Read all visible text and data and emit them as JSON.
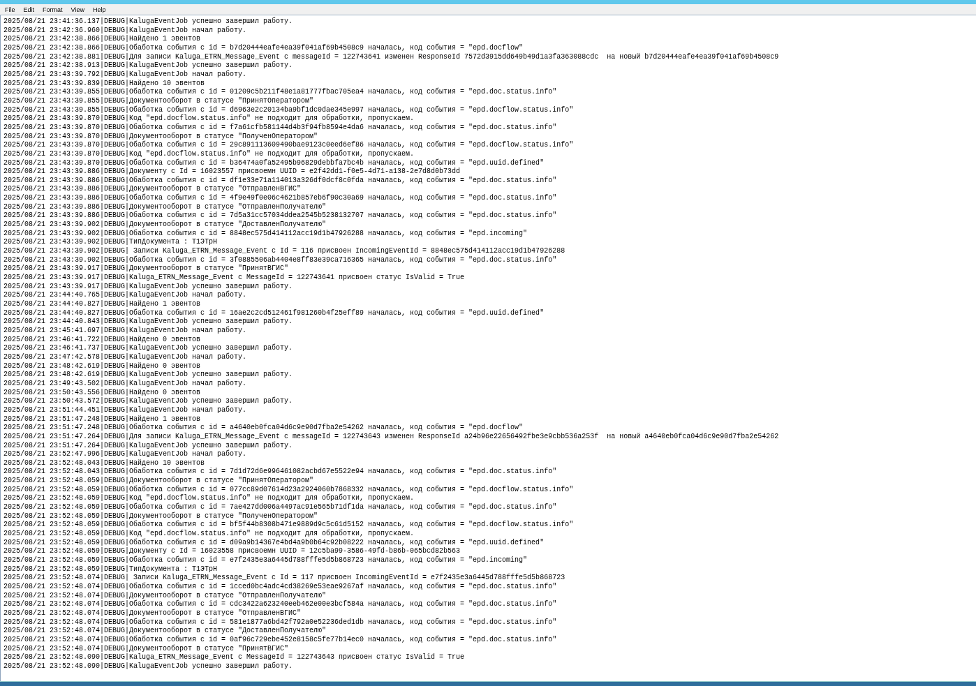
{
  "menu": [
    {
      "label": "File"
    },
    {
      "label": "Edit"
    },
    {
      "label": "Format"
    },
    {
      "label": "View"
    },
    {
      "label": "Help"
    }
  ],
  "lines": [
    "2025/08/21 23:41:36.137|DEBUG|KalugaEventJob успешно завершил работу.",
    "2025/08/21 23:42:36.960|DEBUG|KalugaEventJob начал работу.",
    "2025/08/21 23:42:38.866|DEBUG|Найдено 1 эвентов",
    "2025/08/21 23:42:38.866|DEBUG|Обаботка события с id = b7d20444eafe4ea39f041af69b4508c9 началась, код события = \"epd.docflow\"",
    "2025/08/21 23:42:38.881|DEBUG|Для записи Kaluga_ETRN_Message_Event с messageId = 122743641 изменен ResponseId 7572d3915dd649b49d1a3fa363088cdc  на новый b7d20444eafe4ea39f041af69b4508c9",
    "2025/08/21 23:42:38.913|DEBUG|KalugaEventJob успешно завершил работу.",
    "2025/08/21 23:43:39.792|DEBUG|KalugaEventJob начал работу.",
    "2025/08/21 23:43:39.839|DEBUG|Найдено 10 эвентов",
    "2025/08/21 23:43:39.855|DEBUG|Обаботка события с id = 01209c5b211f48e1a81777fbac705ea4 началась, код события = \"epd.doc.status.info\"",
    "2025/08/21 23:43:39.855|DEBUG|Документооборот в статусе \"ПринятОператором\"",
    "2025/08/21 23:43:39.855|DEBUG|Обаботка события с id = d6963e2c20134ba9bf1dc0dae345e997 началась, код события = \"epd.docflow.status.info\"",
    "2025/08/21 23:43:39.870|DEBUG|Код \"epd.docflow.status.info\" не подходит для обработки, пропускаем.",
    "2025/08/21 23:43:39.870|DEBUG|Обаботка события с id = f7a61cfb581144d4b3f94fb8594e4da6 началась, код события = \"epd.doc.status.info\"",
    "2025/08/21 23:43:39.870|DEBUG|Документооборот в статусе \"ПолученОператором\"",
    "2025/08/21 23:43:39.870|DEBUG|Обаботка события с id = 29c891113609490bae9123c0eed6ef86 началась, код события = \"epd.docflow.status.info\"",
    "2025/08/21 23:43:39.870|DEBUG|Код \"epd.docflow.status.info\" не подходит для обработки, пропускаем.",
    "2025/08/21 23:43:39.870|DEBUG|Обаботка события с id = b36474a0fa52495b96829debbfa7bc4b началась, код события = \"epd.uuid.defined\"",
    "2025/08/21 23:43:39.886|DEBUG|Документу с Id = 16023557 присвоемн UUID = e2f42dd1-f0e5-4d71-a138-2e7d8d0b73dd",
    "2025/08/21 23:43:39.886|DEBUG|Обаботка события с id = df1e33e71a114013a326df0dcf8c0fda началась, код события = \"epd.doc.status.info\"",
    "2025/08/21 23:43:39.886|DEBUG|Документооборот в статусе \"ОтправленВГИС\"",
    "2025/08/21 23:43:39.886|DEBUG|Обаботка события с id = 4f9e49f0e06c4621b857eb6f90c30a69 началась, код события = \"epd.doc.status.info\"",
    "2025/08/21 23:43:39.886|DEBUG|Документооборот в статусе \"ОтправленПолучателю\"",
    "2025/08/21 23:43:39.886|DEBUG|Обаботка события с id = 7d5a31cc57034ddea2545b5238132707 началась, код события = \"epd.doc.status.info\"",
    "2025/08/21 23:43:39.902|DEBUG|Документооборот в статусе \"ДоставленПолучателю\"",
    "2025/08/21 23:43:39.902|DEBUG|Обаботка события с id = 8848ec575d414112acc19d1b47926288 началась, код события = \"epd.incoming\"",
    "2025/08/21 23:43:39.902|DEBUG|ТипДокумента : Т1ЭТрН",
    "2025/08/21 23:43:39.902|DEBUG| Записи Kaluga_ETRN_Message_Event с Id = 116 присвоен IncomingEventId = 8848ec575d414112acc19d1b47926288",
    "2025/08/21 23:43:39.902|DEBUG|Обаботка события с id = 3f0885506ab4404e8ff83e39ca716365 началась, код события = \"epd.doc.status.info\"",
    "2025/08/21 23:43:39.917|DEBUG|Документооборот в статусе \"ПринятВГИС\"",
    "2025/08/21 23:43:39.917|DEBUG|Kaluga_ETRN_Message_Event с MessageId = 122743641 присвоен статус IsValid = True",
    "2025/08/21 23:43:39.917|DEBUG|KalugaEventJob успешно завершил работу.",
    "2025/08/21 23:44:40.765|DEBUG|KalugaEventJob начал работу.",
    "2025/08/21 23:44:40.827|DEBUG|Найдено 1 эвентов",
    "2025/08/21 23:44:40.827|DEBUG|Обаботка события с id = 16ae2c2cd512461f981260b4f25eff89 началась, код события = \"epd.uuid.defined\"",
    "2025/08/21 23:44:40.843|DEBUG|KalugaEventJob успешно завершил работу.",
    "2025/08/21 23:45:41.697|DEBUG|KalugaEventJob начал работу.",
    "2025/08/21 23:46:41.722|DEBUG|Найдено 0 эвентов",
    "2025/08/21 23:46:41.737|DEBUG|KalugaEventJob успешно завершил работу.",
    "2025/08/21 23:47:42.578|DEBUG|KalugaEventJob начал работу.",
    "2025/08/21 23:48:42.619|DEBUG|Найдено 0 эвентов",
    "2025/08/21 23:48:42.619|DEBUG|KalugaEventJob успешно завершил работу.",
    "2025/08/21 23:49:43.502|DEBUG|KalugaEventJob начал работу.",
    "2025/08/21 23:50:43.556|DEBUG|Найдено 0 эвентов",
    "2025/08/21 23:50:43.572|DEBUG|KalugaEventJob успешно завершил работу.",
    "2025/08/21 23:51:44.451|DEBUG|KalugaEventJob начал работу.",
    "2025/08/21 23:51:47.248|DEBUG|Найдено 1 эвентов",
    "2025/08/21 23:51:47.248|DEBUG|Обаботка события с id = a4640eb0fca04d6c9e90d7fba2e54262 началась, код события = \"epd.docflow\"",
    "2025/08/21 23:51:47.264|DEBUG|Для записи Kaluga_ETRN_Message_Event с messageId = 122743643 изменен ResponseId a24b96e22656492fbe3e9cbb536a253f  на новый a4640eb0fca04d6c9e90d7fba2e54262",
    "2025/08/21 23:51:47.264|DEBUG|KalugaEventJob успешно завершил работу.",
    "2025/08/21 23:52:47.996|DEBUG|KalugaEventJob начал работу.",
    "2025/08/21 23:52:48.043|DEBUG|Найдено 10 эвентов",
    "2025/08/21 23:52:48.043|DEBUG|Обаботка события с id = 7d1d72d6e996461082acbd67e5522e94 началась, код события = \"epd.doc.status.info\"",
    "2025/08/21 23:52:48.059|DEBUG|Документооборот в статусе \"ПринятОператором\"",
    "2025/08/21 23:52:48.059|DEBUG|Обаботка события с id = 077cc89d07614d23a2924060b7868332 началась, код события = \"epd.docflow.status.info\"",
    "2025/08/21 23:52:48.059|DEBUG|Код \"epd.docflow.status.info\" не подходит для обработки, пропускаем.",
    "2025/08/21 23:52:48.059|DEBUG|Обаботка события с id = 7ae427dd006a4497ac91e565b71df1da началась, код события = \"epd.doc.status.info\"",
    "2025/08/21 23:52:48.059|DEBUG|Документооборот в статусе \"ПолученОператором\"",
    "2025/08/21 23:52:48.059|DEBUG|Обаботка события с id = bf5f44b8308b471e9889d9c5c61d5152 началась, код события = \"epd.docflow.status.info\"",
    "2025/08/21 23:52:48.059|DEBUG|Код \"epd.docflow.status.info\" не подходит для обработки, пропускаем.",
    "2025/08/21 23:52:48.059|DEBUG|Обаботка события с id = d09a9b14367e4bd4a9b0b64c92b08222 началась, код события = \"epd.uuid.defined\"",
    "2025/08/21 23:52:48.059|DEBUG|Документу с Id = 16023558 присвоемн UUID = 12c5ba99-3586-49fd-b86b-065bcd82b563",
    "2025/08/21 23:52:48.059|DEBUG|Обаботка события с id = e7f2435e3a6445d788fffe5d5b868723 началась, код события = \"epd.incoming\"",
    "2025/08/21 23:52:48.059|DEBUG|ТипДокумента : Т1ЭТрН",
    "2025/08/21 23:52:48.074|DEBUG| Записи Kaluga_ETRN_Message_Event с Id = 117 присвоен IncomingEventId = e7f2435e3a6445d788fffe5d5b868723",
    "2025/08/21 23:52:48.074|DEBUG|Обаботка события с id = 1cced0bc4adc4cd38269e53eae9267af началась, код события = \"epd.doc.status.info\"",
    "2025/08/21 23:52:48.074|DEBUG|Документооборот в статусе \"ОтправленПолучателю\"",
    "2025/08/21 23:52:48.074|DEBUG|Обаботка события с id = cdc3422a623240eeb462e00e3bcf584a началась, код события = \"epd.doc.status.info\"",
    "2025/08/21 23:52:48.074|DEBUG|Документооборот в статусе \"ОтправленВГИС\"",
    "2025/08/21 23:52:48.074|DEBUG|Обаботка события с id = 581e1877a6bd42f792a0e52236ded1db началась, код события = \"epd.doc.status.info\"",
    "2025/08/21 23:52:48.074|DEBUG|Документооборот в статусе \"ДоставленПолучателю\"",
    "2025/08/21 23:52:48.074|DEBUG|Обаботка события с id = 0af96c729ebe452e8158c5fe77b14ec0 началась, код события = \"epd.doc.status.info\"",
    "2025/08/21 23:52:48.074|DEBUG|Документооборот в статусе \"ПринятВГИС\"",
    "2025/08/21 23:52:48.090|DEBUG|Kaluga_ETRN_Message_Event с MessageId = 122743643 присвоен статус IsValid = True",
    "2025/08/21 23:52:48.090|DEBUG|KalugaEventJob успешно завершил работу."
  ]
}
